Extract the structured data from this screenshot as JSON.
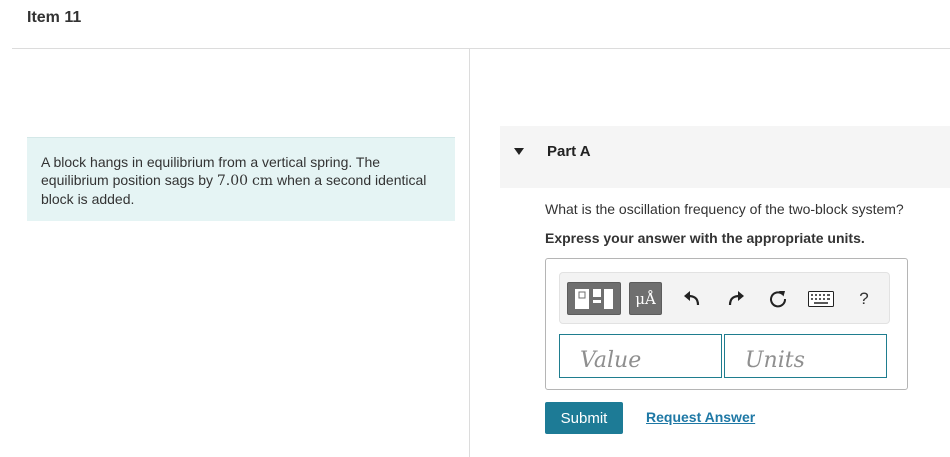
{
  "item": {
    "title": "Item 11"
  },
  "intro": {
    "text_before": "A block hangs in equilibrium from a vertical spring. The equilibrium position sags by ",
    "value": "7.00",
    "unit": "cm",
    "text_after": " when a second identical block is added."
  },
  "part": {
    "title": "Part A",
    "expanded": true
  },
  "question": {
    "text": "What is the oscillation frequency of the two-block system?",
    "instruction": "Express your answer with the appropriate units."
  },
  "toolbar": {
    "units_label": "μÅ",
    "help_label": "?",
    "icons": [
      "templates-icon",
      "units-icon",
      "undo-icon",
      "redo-icon",
      "reset-icon",
      "keyboard-icon",
      "help-icon"
    ]
  },
  "answer": {
    "value_placeholder": "Value",
    "units_placeholder": "Units",
    "value": "",
    "units": ""
  },
  "actions": {
    "submit_label": "Submit",
    "request_label": "Request Answer"
  },
  "colors": {
    "accent": "#1d7b96",
    "link": "#1e78a5",
    "intro_bg": "#e5f4f4",
    "input_border": "#1f7d8f"
  }
}
